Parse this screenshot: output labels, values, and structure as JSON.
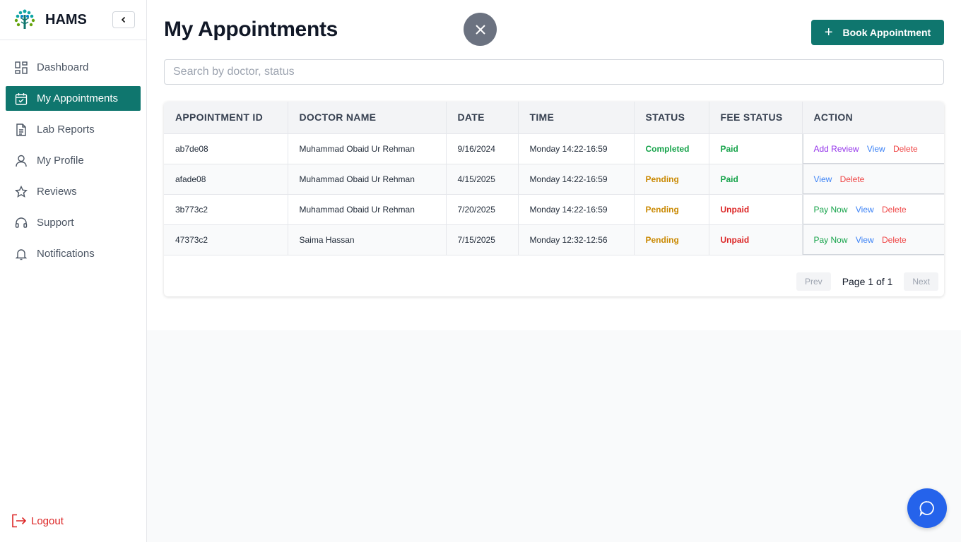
{
  "brand": {
    "name": "HAMS"
  },
  "sidebar": {
    "items": [
      {
        "label": "Dashboard",
        "icon": "dashboard-icon"
      },
      {
        "label": "My Appointments",
        "icon": "calendar-check-icon",
        "active": true
      },
      {
        "label": "Lab Reports",
        "icon": "document-icon"
      },
      {
        "label": "My Profile",
        "icon": "user-icon"
      },
      {
        "label": "Reviews",
        "icon": "star-icon"
      },
      {
        "label": "Support",
        "icon": "headset-icon"
      },
      {
        "label": "Notifications",
        "icon": "bell-icon"
      }
    ],
    "logout_label": "Logout"
  },
  "header": {
    "title": "My Appointments",
    "book_label": "Book Appointment"
  },
  "search": {
    "placeholder": "Search by doctor, status",
    "value": ""
  },
  "table": {
    "columns": [
      "APPOINTMENT ID",
      "DOCTOR NAME",
      "DATE",
      "TIME",
      "STATUS",
      "FEE STATUS",
      "ACTION"
    ],
    "rows": [
      {
        "id": "ab7de08",
        "doctor": "Muhammad Obaid Ur Rehman",
        "date": "9/16/2024",
        "time": "Monday 14:22-16:59",
        "status": "Completed",
        "fee": "Paid",
        "actions": [
          "Add Review",
          "View",
          "Delete"
        ]
      },
      {
        "id": "afade08",
        "doctor": "Muhammad Obaid Ur Rehman",
        "date": "4/15/2025",
        "time": "Monday 14:22-16:59",
        "status": "Pending",
        "fee": "Paid",
        "actions": [
          "View",
          "Delete"
        ]
      },
      {
        "id": "3b773c2",
        "doctor": "Muhammad Obaid Ur Rehman",
        "date": "7/20/2025",
        "time": "Monday 14:22-16:59",
        "status": "Pending",
        "fee": "Unpaid",
        "actions": [
          "Pay Now",
          "View",
          "Delete"
        ]
      },
      {
        "id": "47373c2",
        "doctor": "Saima Hassan",
        "date": "7/15/2025",
        "time": "Monday 12:32-12:56",
        "status": "Pending",
        "fee": "Unpaid",
        "actions": [
          "Pay Now",
          "View",
          "Delete"
        ]
      }
    ]
  },
  "pagination": {
    "prev_label": "Prev",
    "page_text": "Page 1 of 1",
    "next_label": "Next"
  },
  "colors": {
    "primary": "#0f766e",
    "chat": "#2563eb",
    "danger": "#dc2626"
  }
}
